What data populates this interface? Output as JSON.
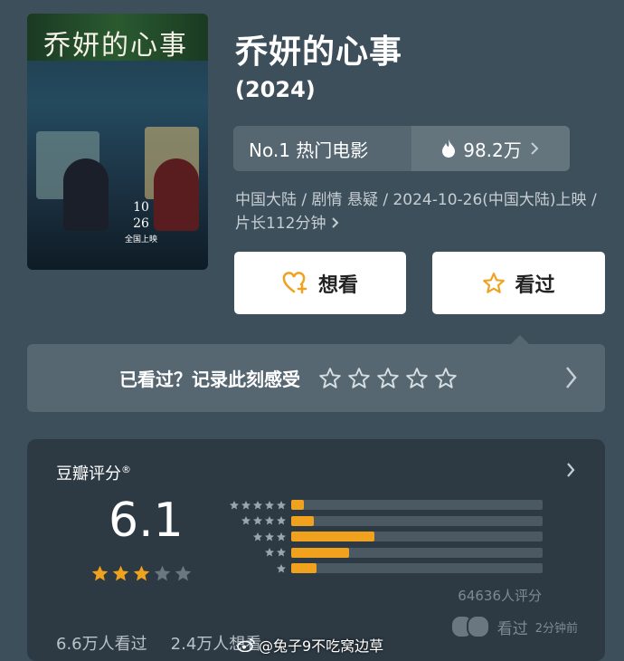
{
  "poster": {
    "title_text": "乔妍的心事",
    "date_line1": "10",
    "date_line2": "26",
    "date_line3": "全国上映"
  },
  "movie": {
    "title": "乔妍的心事",
    "year": "(2024)",
    "rank_label": "No.1 热门电影",
    "hot_count": "98.2万",
    "meta": "中国大陆 / 剧情 悬疑 / 2024-10-26(中国大陆)上映 / 片长112分钟"
  },
  "actions": {
    "want_label": "想看",
    "seen_label": "看过"
  },
  "record": {
    "label": "已看过？记录此刻感受"
  },
  "rating": {
    "title": "豆瓣评分",
    "registered_mark": "®",
    "score": "6.1",
    "stars_filled": 3,
    "count": "64636人评分",
    "distribution": [
      {
        "stars": 5,
        "fraction": 0.05
      },
      {
        "stars": 4,
        "fraction": 0.09
      },
      {
        "stars": 3,
        "fraction": 0.33
      },
      {
        "stars": 2,
        "fraction": 0.23
      },
      {
        "stars": 1,
        "fraction": 0.1
      }
    ],
    "footer_seen": "6.6万人看过",
    "footer_want": "2.4万人想看",
    "seen_tag": "看过",
    "seen_time": "2分钟前"
  },
  "watermark": "@兔子9不吃窝边草",
  "colors": {
    "accent": "#f0a11e",
    "background": "#3d4f5b",
    "card": "#2d3a44"
  }
}
